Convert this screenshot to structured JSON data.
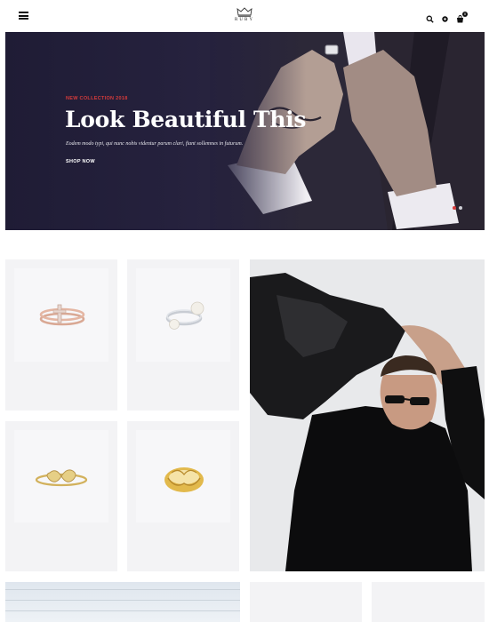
{
  "header": {
    "logo_text": "RUBY",
    "menu_icon": "hamburger-menu-icon",
    "icons": [
      "search-icon",
      "user-icon",
      "cart-icon"
    ],
    "cart_count": "0"
  },
  "hero": {
    "tag": "NEW COLLECTION 2018",
    "title": "Look Beautiful This",
    "subtitle": "Eodem modo typi, qui nunc nobis videntur parum clari, fiant sollemnes in futurum.",
    "button": "SHOP NOW",
    "slides": 2,
    "active_slide": 1
  },
  "colors": {
    "accent": "#d63b3b",
    "hero_bg": "#25213d",
    "tile_bg": "#f3f3f5"
  },
  "products": [
    {
      "name": "rose-gold-crossover-ring"
    },
    {
      "name": "silver-pearl-open-ring"
    },
    {
      "name": "gold-infinity-ring"
    },
    {
      "name": "gold-twisted-ring"
    }
  ]
}
